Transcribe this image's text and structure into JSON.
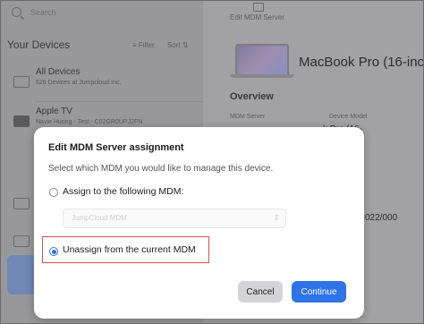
{
  "sidebar": {
    "search_placeholder": "Search",
    "section_title": "Your Devices",
    "filter_label": "Filter",
    "sort_label": "Sort",
    "devices": [
      {
        "title": "All Devices",
        "subtitle": "626 Devices at Jumpcloud Inc."
      },
      {
        "title": "Apple TV",
        "subtitle": "Navie Huong - Test - C02GR0UPJ2FN"
      }
    ]
  },
  "detail": {
    "top_action": "Edit MDM Server",
    "model_title": "MacBook Pro (16-inc",
    "overview_heading": "Overview",
    "mdm_server_label": "MDM Server",
    "device_model_label": "Device Model",
    "model_peek": "k Pro (16-",
    "serial_peek": "VM022/000"
  },
  "modal": {
    "title": "Edit MDM Server assignment",
    "description": "Select which MDM you would like to manage this device.",
    "option_assign": "Assign to the following MDM:",
    "select_value": "JumpCloud MDM",
    "option_unassign": "Unassign from the current MDM",
    "selected_option": "unassign",
    "cancel_label": "Cancel",
    "continue_label": "Continue"
  },
  "colors": {
    "accent": "#2f73e8",
    "highlight_box": "#d9534f"
  }
}
